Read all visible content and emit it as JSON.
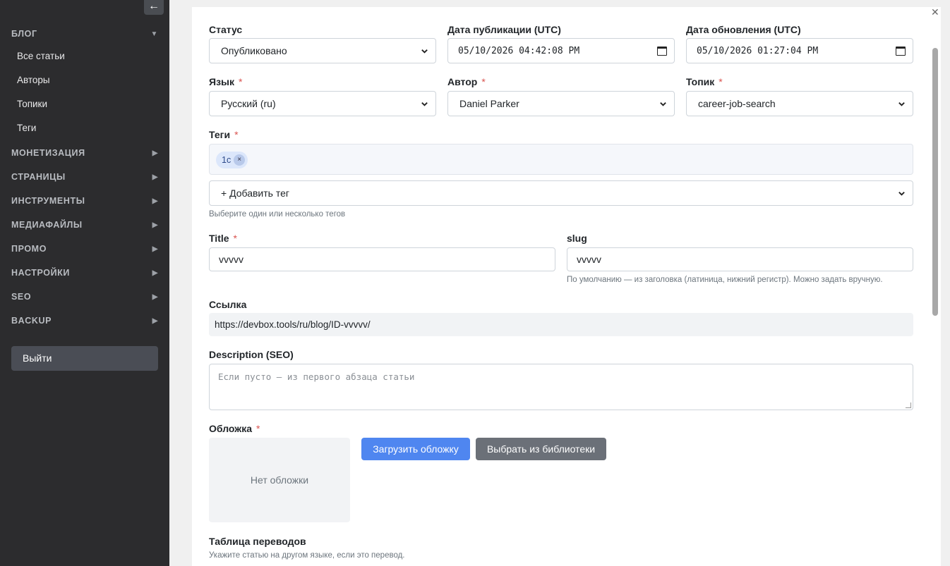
{
  "sidebar": {
    "collapse_icon": "←",
    "blog": {
      "label": "БЛОГ",
      "arrow": "▼",
      "items": [
        "Все статьи",
        "Авторы",
        "Топики",
        "Теги"
      ]
    },
    "sections": [
      {
        "label": "МОНЕТИЗАЦИЯ",
        "arrow": "▶"
      },
      {
        "label": "СТРАНИЦЫ",
        "arrow": "▶"
      },
      {
        "label": "ИНСТРУМЕНТЫ",
        "arrow": "▶"
      },
      {
        "label": "МЕДИАФАЙЛЫ",
        "arrow": "▶"
      },
      {
        "label": "ПРОМО",
        "arrow": "▶"
      },
      {
        "label": "НАСТРОЙКИ",
        "arrow": "▶"
      },
      {
        "label": "SEO",
        "arrow": "▶"
      },
      {
        "label": "BACKUP",
        "arrow": "▶"
      }
    ],
    "logout": "Выйти"
  },
  "form": {
    "close_icon": "✕",
    "status": {
      "label": "Статус",
      "value": "Опубликовано"
    },
    "published": {
      "label": "Дата публикации (UTC)",
      "value": "05/10/2026 04:42:08 PM"
    },
    "updated": {
      "label": "Дата обновления (UTC)",
      "value": "05/10/2026 01:27:04 PM"
    },
    "language": {
      "label": "Язык",
      "required": "*",
      "value": "Русский (ru)"
    },
    "author": {
      "label": "Автор",
      "required": "*",
      "value": "Daniel Parker"
    },
    "topic": {
      "label": "Топик",
      "required": "*",
      "value": "career-job-search"
    },
    "tags": {
      "label": "Теги",
      "required": "*",
      "chips": [
        "1c"
      ],
      "chip_remove": "×",
      "add": "+ Добавить тег",
      "hint": "Выберите один или несколько тегов"
    },
    "title": {
      "label": "Title",
      "required": "*",
      "value": "vvvvv"
    },
    "slug": {
      "label": "slug",
      "value": "vvvvv",
      "hint": "По умолчанию — из заголовка (латиница, нижний регистр). Можно задать вручную."
    },
    "link": {
      "label": "Ссылка",
      "value": "https://devbox.tools/ru/blog/ID-vvvvv/"
    },
    "description": {
      "label": "Description (SEO)",
      "placeholder": "Если пусто — из первого абзаца статьи"
    },
    "cover": {
      "label": "Обложка",
      "required": "*",
      "empty": "Нет обложки",
      "upload": "Загрузить обложку",
      "library": "Выбрать из библиотеки"
    },
    "translations": {
      "label": "Таблица переводов",
      "hint": "Укажите статью на другом языке, если это перевод."
    }
  },
  "colors": {
    "sidebar_bg": "#2c2c2e",
    "primary": "#4f86f0",
    "secondary": "#6b7078",
    "required": "#d9534f"
  }
}
